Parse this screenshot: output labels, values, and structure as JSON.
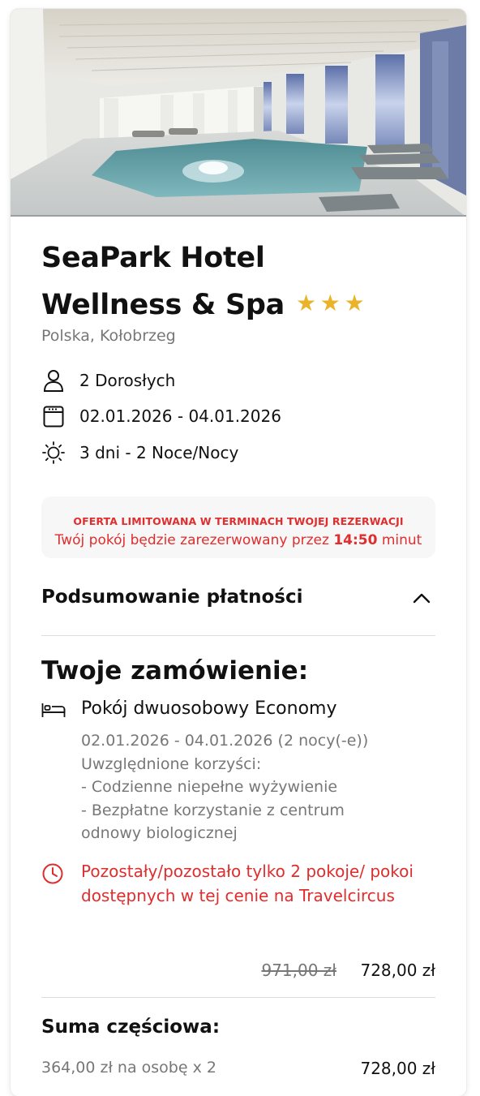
{
  "hotel": {
    "name_line1": "SeaPark Hotel",
    "name_line2": "Wellness & Spa",
    "stars": 3,
    "location": "Polska, Kołobrzeg"
  },
  "booking": {
    "guests": "2 Dorosłych",
    "dates": "02.01.2026 - 04.01.2026",
    "duration": "3 dni - 2 Noce/Nocy"
  },
  "alert": {
    "headline": "OFERTA LIMITOWANA W TERMINACH TWOJEJ REZERWACJI",
    "text_before": "Twój pokój będzie zarezerwowany przez ",
    "time": "14:50",
    "text_after": " minut"
  },
  "summary": {
    "title": "Podsumowanie płatności",
    "toggle_icon": "chevron-up-icon"
  },
  "order": {
    "title": "Twoje zamówienie:",
    "room_name": "Pokój dwuosobowy Economy",
    "room_dates": "02.01.2026 - 04.01.2026 (2 nocy(-e))",
    "benefits_label": "Uwzględnione korzyści:",
    "benefit_1": "- Codzienne niepełne wyżywienie",
    "benefit_2a": "- Bezpłatne korzystanie z centrum",
    "benefit_2b": "odnowy biologicznej",
    "availability_warning": "Pozostały/pozostało tylko 2 pokoje/ pokoi dostępnych w tej cenie na Travelcircus",
    "old_price": "971,00 zł",
    "new_price": "728,00 zł"
  },
  "subtotal": {
    "title": "Suma częściowa:",
    "per_person": "364,00 zł na osobę x 2",
    "total": "728,00 zł"
  },
  "colors": {
    "accent_red": "#e02d2d",
    "star_gold": "#e9b32a",
    "muted_text": "#777777"
  },
  "icons": [
    "person-icon",
    "calendar-icon",
    "sun-icon",
    "bed-icon",
    "clock-icon",
    "chevron-up-icon",
    "star-icon"
  ]
}
